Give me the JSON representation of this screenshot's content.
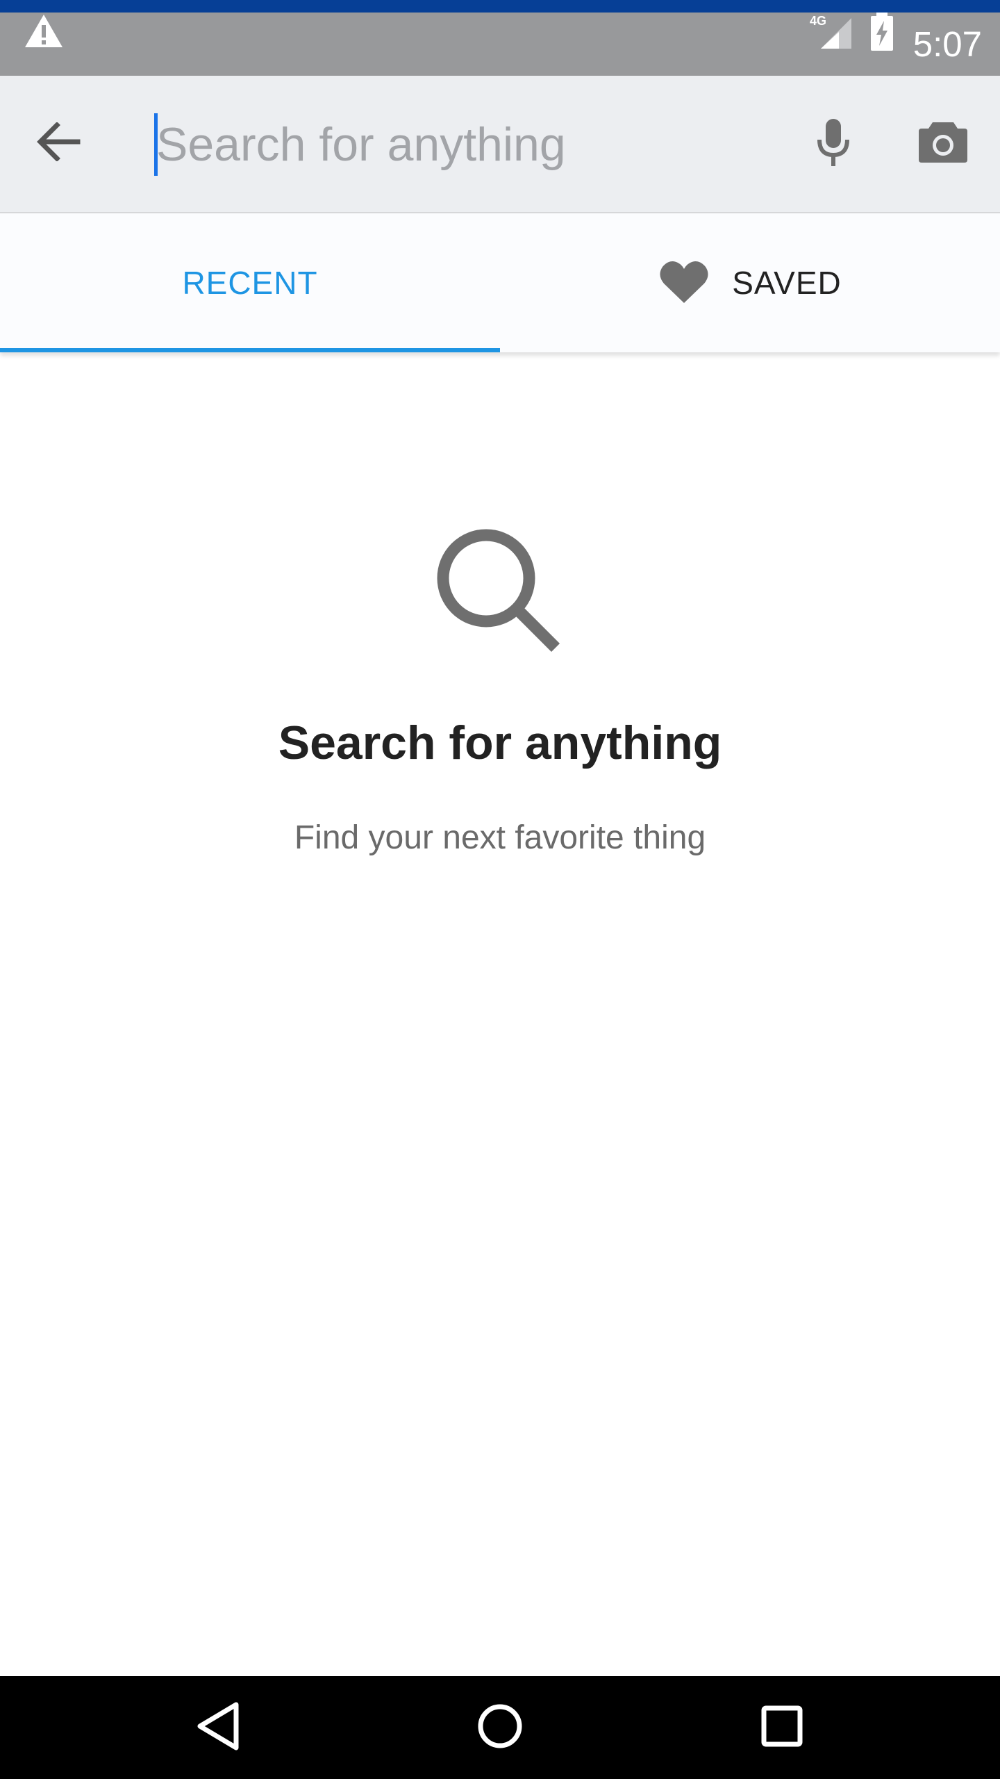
{
  "status_bar": {
    "time": "5:07",
    "network": "4G",
    "icons": [
      "warning-icon",
      "signal-icon",
      "battery-charging-icon"
    ]
  },
  "search": {
    "placeholder": "Search for anything",
    "value": "",
    "icons": [
      "back-arrow-icon",
      "microphone-icon",
      "camera-icon"
    ]
  },
  "tabs": {
    "recent_label": "RECENT",
    "saved_label": "SAVED",
    "active": "RECENT",
    "saved_icon": "heart-icon"
  },
  "empty_state": {
    "icon": "search-icon",
    "title": "Search for anything",
    "subtitle": "Find your next favorite thing"
  },
  "nav_bar": {
    "icons": [
      "back-triangle-icon",
      "home-circle-icon",
      "recents-square-icon"
    ]
  },
  "colors": {
    "accent": "#1e95e3",
    "status_bar": "#98999b",
    "search_bar": "#eceef1",
    "icon_gray": "#6f6f6f"
  }
}
